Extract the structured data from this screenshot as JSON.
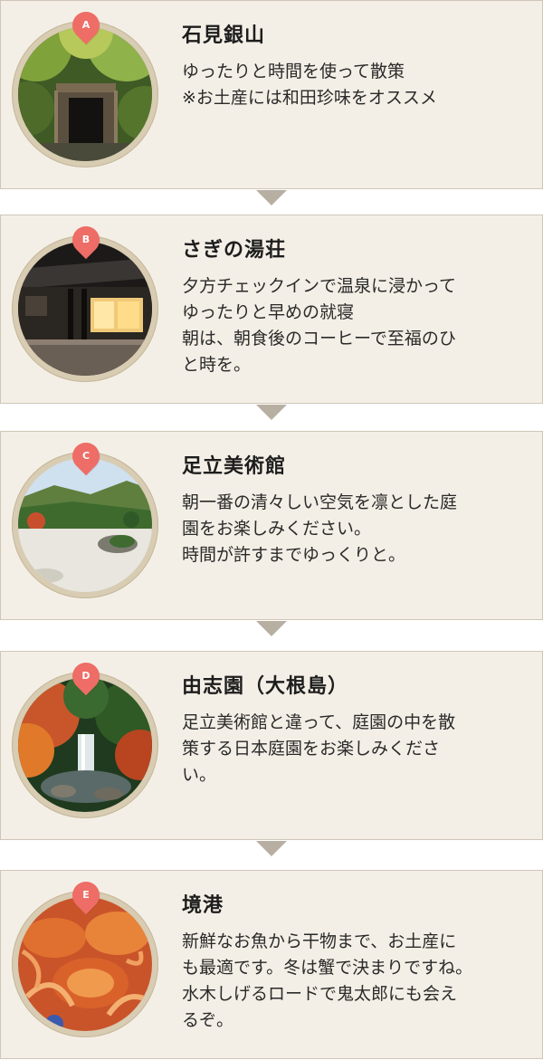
{
  "spots": [
    {
      "letter": "A",
      "name": "石見銀山",
      "lines": [
        "ゆったりと時間を使って散策",
        "※お土産には和田珍味をオススメ"
      ],
      "photo": "mine-entrance-in-forest"
    },
    {
      "letter": "B",
      "name": "さぎの湯荘",
      "lines": [
        "夕方チェックインで温泉に浸かって",
        "ゆったりと早めの就寝",
        "朝は、朝食後のコーヒーで至福のひ",
        "と時を。"
      ],
      "photo": "japanese-inn-at-dusk"
    },
    {
      "letter": "C",
      "name": "足立美術館",
      "lines": [
        "朝一番の清々しい空気を凛とした庭",
        "園をお楽しみください。",
        "時間が許すまでゆっくりと。"
      ],
      "photo": "dry-landscape-garden"
    },
    {
      "letter": "D",
      "name": "由志園（大根島）",
      "lines": [
        "足立美術館と違って、庭園の中を散",
        "策する日本庭園をお楽しみくださ",
        "い。"
      ],
      "photo": "autumn-garden-waterfall"
    },
    {
      "letter": "E",
      "name": "境港",
      "lines": [
        "新鮮なお魚から干物まで、お土産に",
        "も最適です。冬は蟹で決まりですね。",
        "水木しげるロードで鬼太郎にも会え",
        "るぞ。"
      ],
      "photo": "snow-crabs"
    }
  ],
  "colors": {
    "card_bg": "#f4efe6",
    "card_border": "#cfc6b8",
    "pin": "#ee6d66",
    "connector": "#b8afa3",
    "ring": "#d8ccb3"
  }
}
